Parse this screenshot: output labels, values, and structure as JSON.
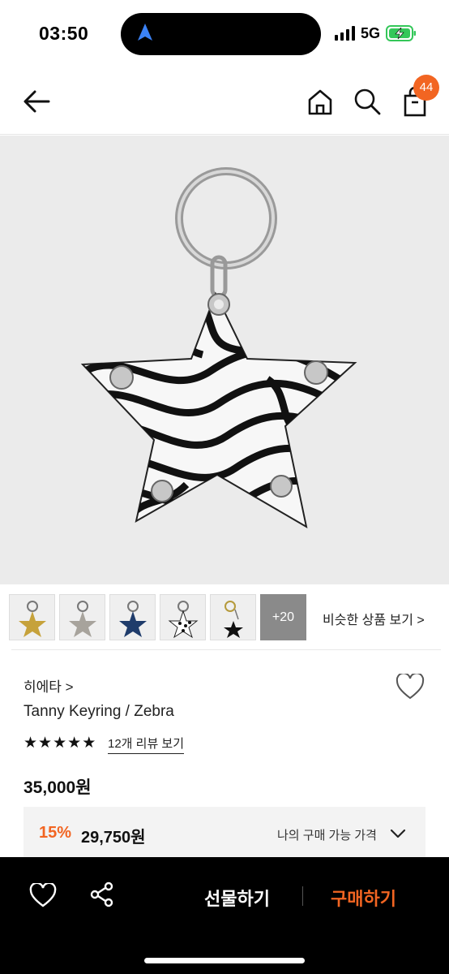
{
  "status_bar": {
    "time": "03:50",
    "network": "5G"
  },
  "header": {
    "cart_count": "44",
    "icons": [
      "back-arrow-icon",
      "home-icon",
      "search-icon",
      "shopping-bag-icon"
    ]
  },
  "hero": {
    "image": "zebra-print star keyring on silver ring"
  },
  "thumbnails": {
    "items": [
      "gold-glitter-star",
      "silver-star",
      "navy-star",
      "polka-dot-star",
      "black-star-charm"
    ],
    "more_label": "+20"
  },
  "similar_link": "비슷한 상품 보기 >",
  "product": {
    "brand": "히에타 >",
    "name": "Tanny Keyring / Zebra",
    "rating_stars": 5,
    "review_link": "12개 리뷰 보기",
    "price": "35,000원"
  },
  "price_box": {
    "discount": "15%",
    "sale_price": "29,750원",
    "my_price_label": "나의 구매 가능 가격"
  },
  "bottom_bar": {
    "gift_label": "선물하기",
    "buy_label": "구매하기"
  },
  "colors": {
    "accent": "#f26522",
    "bar": "#000000"
  }
}
